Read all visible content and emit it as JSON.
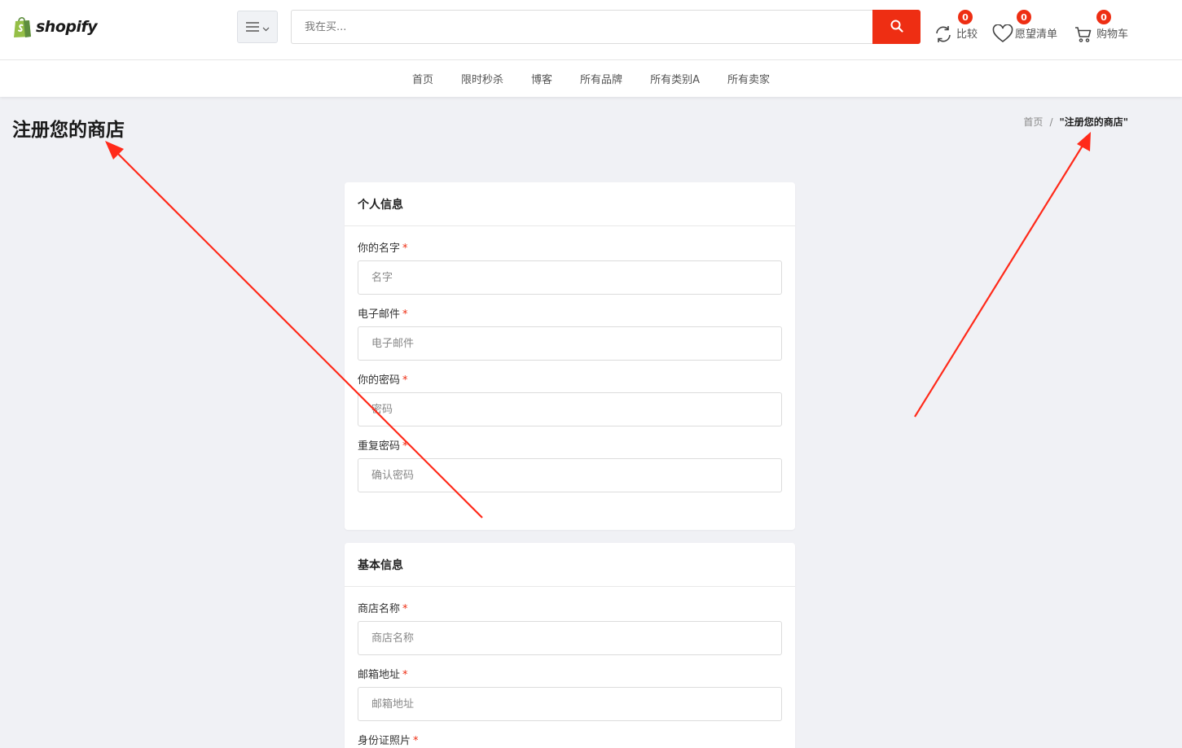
{
  "header": {
    "logo_text": "shopify",
    "search_placeholder": "我在买...",
    "compare": {
      "label": "比较",
      "count": "0"
    },
    "wishlist": {
      "label": "愿望清单",
      "count": "0"
    },
    "cart": {
      "label": "购物车",
      "count": "0"
    }
  },
  "nav": {
    "items": [
      "首页",
      "限时秒杀",
      "博客",
      "所有品牌",
      "所有类别A",
      "所有卖家"
    ]
  },
  "page": {
    "title": "注册您的商店",
    "breadcrumb": {
      "home": "首页",
      "separator": "/",
      "current": "\"注册您的商店\""
    }
  },
  "personal_info": {
    "heading": "个人信息",
    "fields": [
      {
        "label": "你的名字",
        "required": "*",
        "placeholder": "名字"
      },
      {
        "label": "电子邮件",
        "required": "*",
        "placeholder": "电子邮件"
      },
      {
        "label": "你的密码",
        "required": "*",
        "placeholder": "密码"
      },
      {
        "label": "重复密码",
        "required": "*",
        "placeholder": "确认密码"
      }
    ]
  },
  "basic_info": {
    "heading": "基本信息",
    "fields": [
      {
        "label": "商店名称",
        "required": "*",
        "placeholder": "商店名称"
      },
      {
        "label": "邮箱地址",
        "required": "*",
        "placeholder": "邮箱地址"
      },
      {
        "label": "身份证照片",
        "required": "*",
        "placeholder": ""
      }
    ]
  },
  "colors": {
    "accent": "#ee2e13",
    "page_bg": "#f0f1f5",
    "annotation_arrow": "#ff2a1a"
  },
  "icons": [
    "shopify-bag-icon",
    "hamburger-menu-icon",
    "chevron-down-icon",
    "search-icon",
    "compare-icon",
    "heart-icon",
    "cart-icon"
  ]
}
